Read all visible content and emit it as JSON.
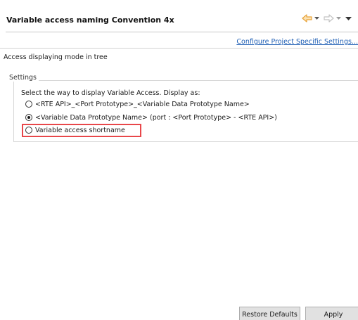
{
  "header": {
    "title": "Variable access naming Convention 4x",
    "nav_icons": [
      "back-arrow-icon",
      "chevron-down-icon",
      "forward-arrow-icon",
      "chevron-down-icon",
      "view-menu-icon"
    ]
  },
  "config_link": "Configure Project Specific Settings...",
  "access_mode_label": "Access displaying mode in tree",
  "settings_group": {
    "legend": "Settings",
    "instruction": "Select the way to display Variable Access. Display as:",
    "options": [
      {
        "label": "<RTE API>_<Port Prototype>_<Variable Data Prototype Name>",
        "checked": false
      },
      {
        "label": "<Variable Data Prototype Name> (port : <Port Prototype> - <RTE API>)",
        "checked": true
      },
      {
        "label": "Variable access shortname",
        "checked": false,
        "highlighted": true
      }
    ]
  },
  "buttons": {
    "restore_defaults": "Restore Defaults",
    "apply": "Apply"
  },
  "colors": {
    "link": "#2160b5",
    "highlight": "#e8474a",
    "nav_icon": "#e8a33a",
    "nav_icon_disabled": "#9a9a9a"
  }
}
